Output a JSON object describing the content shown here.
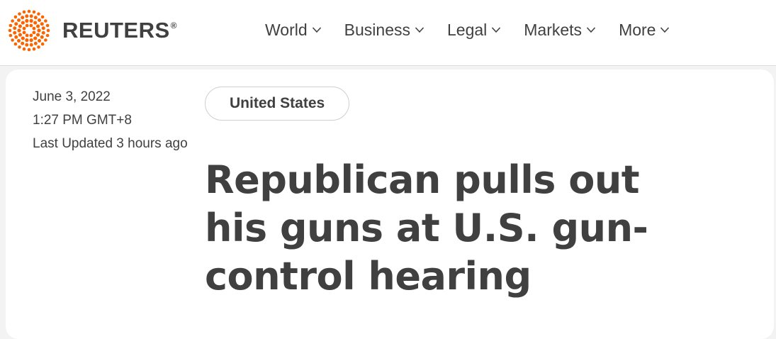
{
  "brand": {
    "name": "REUTERS",
    "registered_mark": "®",
    "logo_color": "#fa6400"
  },
  "nav": {
    "items": [
      {
        "label": "World"
      },
      {
        "label": "Business"
      },
      {
        "label": "Legal"
      },
      {
        "label": "Markets"
      },
      {
        "label": "More"
      }
    ]
  },
  "article": {
    "date": "June 3, 2022",
    "time": "1:27 PM GMT+8",
    "updated": "Last Updated 3 hours ago",
    "section": "United States",
    "headline": "Republican pulls out his guns at U.S. gun-control hearing"
  },
  "colors": {
    "text": "#404040",
    "background": "#f3f3f3",
    "card": "#ffffff",
    "accent": "#fa6400"
  },
  "icons": {
    "logo": "reuters-dot-logo-icon",
    "chevron": "chevron-down-icon"
  }
}
